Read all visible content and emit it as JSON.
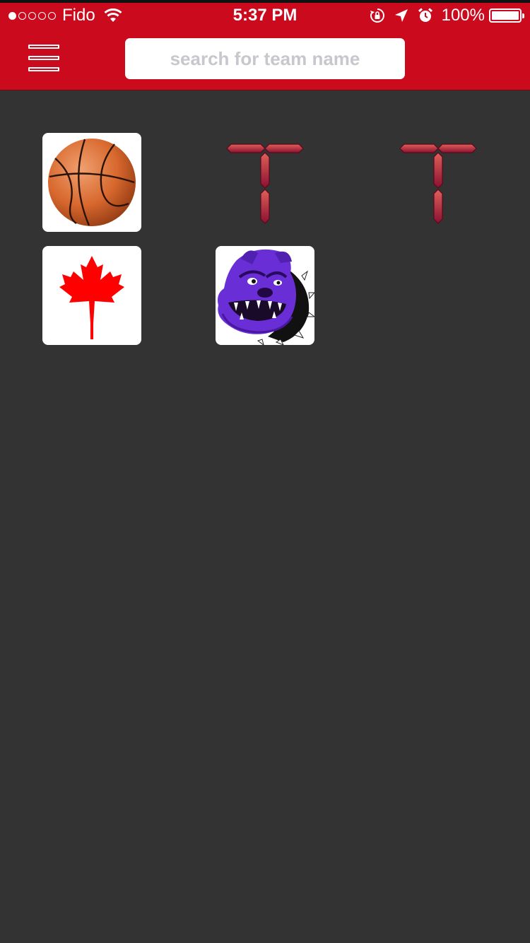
{
  "status_bar": {
    "carrier": "Fido",
    "time": "5:37 PM",
    "battery": "100%",
    "signal_strength": 1,
    "signal_max": 5,
    "icons": [
      "wifi-icon",
      "rotation-lock-icon",
      "location-arrow-icon",
      "alarm-icon",
      "battery-icon"
    ]
  },
  "header": {
    "menu_icon": "hamburger-menu-icon",
    "search_placeholder": "search for team name",
    "search_value": "",
    "background_color": "#cc0a1e"
  },
  "teams": [
    {
      "logo": "basketball-logo"
    },
    {
      "logo": "t-logo"
    },
    {
      "logo": "t-logo"
    },
    {
      "logo": "maple-leaf-logo"
    },
    {
      "logo": "bulldog-logo"
    }
  ],
  "colors": {
    "background": "#333333",
    "accent": "#cc0a1e",
    "basketball": "#d8682e",
    "maple_leaf": "#ff0000",
    "bulldog": "#6a2ed6",
    "t_logo": "#b83a46"
  }
}
